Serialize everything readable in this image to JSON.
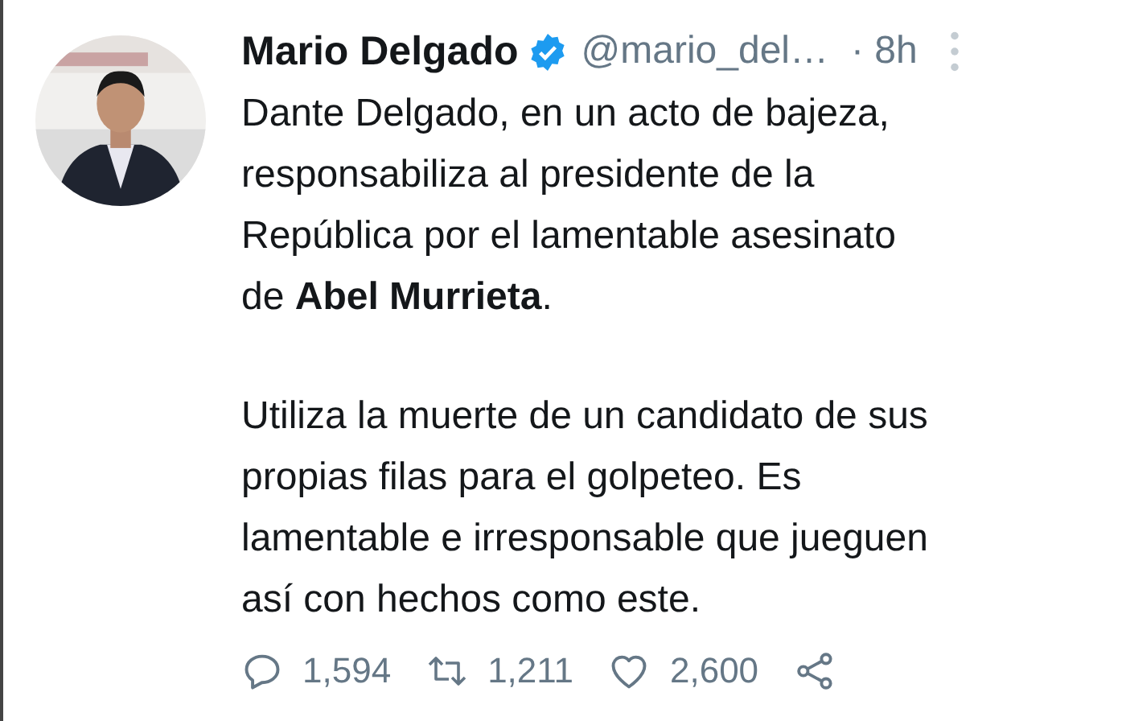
{
  "tweet": {
    "author": {
      "name": "Mario Delgado",
      "verified": true,
      "handle": "@mario_del…",
      "time": "· 8h"
    },
    "paragraphs": [
      "Dante Delgado, en un acto de bajeza,\nresponsabiliza al presidente de la\nRepública por el lamentable asesinato\nde **Abel Murrieta**.",
      "Utiliza la muerte de un candidato de sus\npropias filas para el golpeteo. Es\nlamentable e irresponsable que jueguen\nasí con hechos como este."
    ],
    "actions": [
      {
        "kind": "reply",
        "count": "1,594"
      },
      {
        "kind": "retweet",
        "count": "1,211"
      },
      {
        "kind": "like",
        "count": "2,600"
      },
      {
        "kind": "share"
      }
    ]
  }
}
